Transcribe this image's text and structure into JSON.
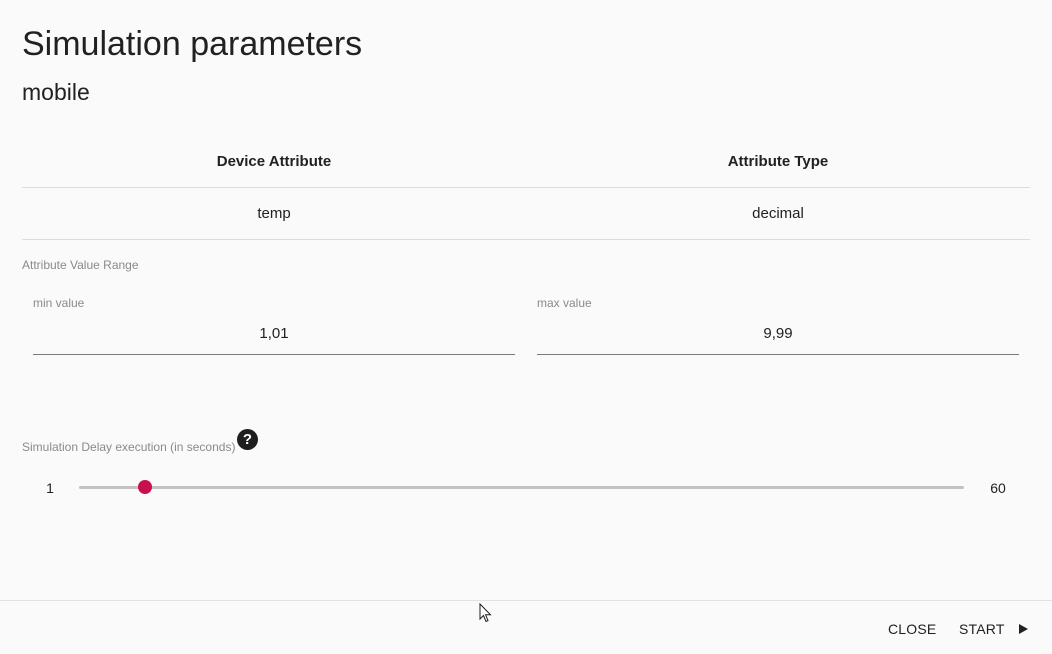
{
  "dialog": {
    "title": "Simulation parameters",
    "subtitle": "mobile"
  },
  "table": {
    "headers": [
      "Device Attribute",
      "Attribute Type"
    ],
    "rows": [
      [
        "temp",
        "decimal"
      ]
    ]
  },
  "range": {
    "label": "Attribute Value Range",
    "min_label": "min value",
    "min_value": "1,01",
    "max_label": "max value",
    "max_value": "9,99"
  },
  "delay": {
    "label": "Simulation Delay execution (in seconds)",
    "help_icon": "question-circle-icon",
    "slider_min": "1",
    "slider_max": "60",
    "slider_fraction": 0.075,
    "accent_color": "#c8104e"
  },
  "footer": {
    "close_label": "CLOSE",
    "start_label": "START",
    "start_icon": "play-icon"
  }
}
